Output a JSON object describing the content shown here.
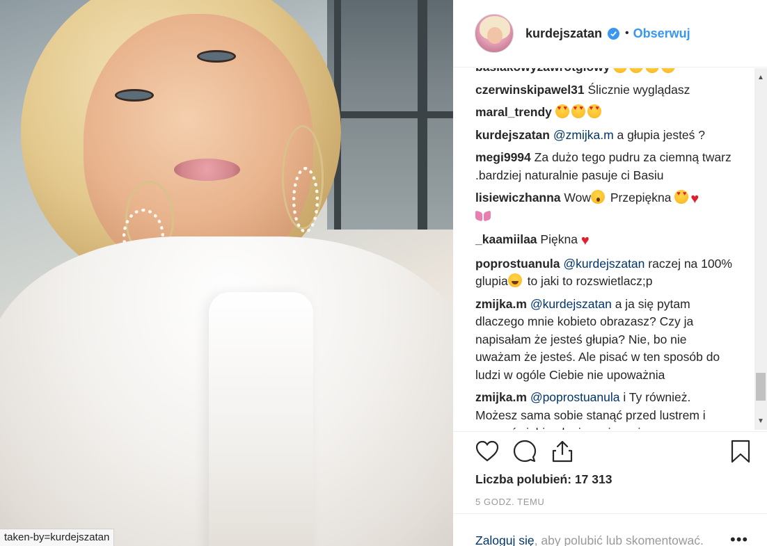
{
  "photo": {
    "url_tag": "taken-by=kurdejszatan"
  },
  "header": {
    "username": "kurdejszatan",
    "separator": "•",
    "follow_label": "Obserwuj"
  },
  "comments": [
    {
      "user": "basiakowyzawrotglowy",
      "parts": [
        {
          "t": "emoji",
          "v": "heart-eyes"
        },
        {
          "t": "emoji",
          "v": "heart-eyes"
        },
        {
          "t": "emoji",
          "v": "heart-eyes"
        },
        {
          "t": "emoji",
          "v": "heart-eyes"
        }
      ]
    },
    {
      "user": "czerwinskipawel31",
      "text": "Ślicznie wyglądasz"
    },
    {
      "user": "maral_trendy",
      "parts": [
        {
          "t": "emoji",
          "v": "heart-eyes"
        },
        {
          "t": "emoji",
          "v": "heart-eyes"
        },
        {
          "t": "emoji",
          "v": "heart-eyes"
        }
      ]
    },
    {
      "user": "kurdejszatan",
      "mention": "@zmijka.m",
      "text": "a głupia jesteś ?"
    },
    {
      "user": "megi9994",
      "text": "Za dużo tego pudru za ciemną twarz .bardziej naturalnie pasuje ci Basiu"
    },
    {
      "user": "lisiewiczhanna",
      "text_a": "Wow",
      "text_b": "Przepiękna"
    },
    {
      "user": "_kaamiilaa",
      "text": "Piękna"
    },
    {
      "user": "poprostuanula",
      "mention": "@kurdejszatan",
      "text_a": "raczej na 100% glupia",
      "text_b": "to jaki to rozswietlacz;p"
    },
    {
      "user": "zmijka.m",
      "mention": "@kurdejszatan",
      "text": "a ja się pytam dlaczego mnie kobieto obrazasz? Czy ja napisałam że jesteś głupia? Nie, bo nie uważam że jesteś. Ale pisać w ten sposób do ludzi w ogóle Ciebie nie upoważnia"
    },
    {
      "user": "zmijka.m",
      "mention": "@poprostuanula",
      "text": "i Ty również. Możesz sama sobie stanąć przed lustrem i nazwać siebie głupia a nie mnie"
    }
  ],
  "likes": {
    "label": "Liczba polubień: 17 313"
  },
  "time": {
    "label": "5 GODZ. TEMU"
  },
  "login": {
    "link": "Zaloguj się",
    "text": ", aby polubić lub skomentować.",
    "more": "•••"
  },
  "icons": {
    "like": "heart-icon",
    "comment": "comment-icon",
    "share": "share-icon",
    "save": "bookmark-icon",
    "verified": "verified-badge-icon"
  },
  "colors": {
    "accent": "#3897f0",
    "mention": "#003569",
    "muted": "#999999",
    "text": "#262626"
  }
}
